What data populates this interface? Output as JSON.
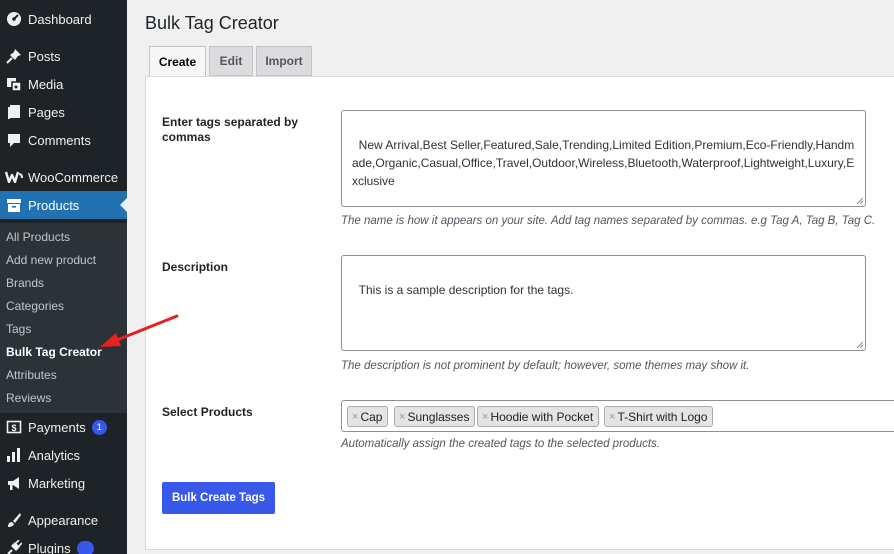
{
  "sidebar": {
    "menu": [
      {
        "label": "Dashboard",
        "icon": "dashboard-icon"
      },
      {
        "label": "Posts",
        "icon": "pin-icon"
      },
      {
        "label": "Media",
        "icon": "media-icon"
      },
      {
        "label": "Pages",
        "icon": "pages-icon"
      },
      {
        "label": "Comments",
        "icon": "comment-icon"
      },
      {
        "label": "WooCommerce",
        "icon": "woo-icon"
      },
      {
        "label": "Products",
        "icon": "archive-icon"
      }
    ],
    "submenu": [
      "All Products",
      "Add new product",
      "Brands",
      "Categories",
      "Tags",
      "Bulk Tag Creator",
      "Attributes",
      "Reviews"
    ],
    "menu_bottom": [
      {
        "label": "Payments",
        "icon": "payments-icon",
        "badge": "1"
      },
      {
        "label": "Analytics",
        "icon": "analytics-icon"
      },
      {
        "label": "Marketing",
        "icon": "megaphone-icon"
      },
      {
        "label": "Appearance",
        "icon": "brush-icon"
      },
      {
        "label": "Plugins",
        "icon": "plugin-icon"
      }
    ]
  },
  "page": {
    "title": "Bulk Tag Creator",
    "tabs": [
      "Create",
      "Edit",
      "Import"
    ],
    "active_tab": "Create"
  },
  "form": {
    "tags_label": "Enter tags separated by commas",
    "tags_value": "New Arrival,Best Seller,Featured,Sale,Trending,Limited Edition,Premium,Eco-Friendly,Handmade,Organic,Casual,Office,Travel,Outdoor,Wireless,Bluetooth,Waterproof,Lightweight,Luxury,Exclusive",
    "tags_help": "The name is how it appears on your site. Add tag names separated by commas. e.g Tag A, Tag B, Tag C.",
    "description_label": "Description",
    "description_value": "This is a sample description for the tags.",
    "description_help": "The description is not prominent by default; however, some themes may show it.",
    "products_label": "Select Products",
    "products": [
      "Cap",
      "Sunglasses",
      "Hoodie with Pocket",
      "T-Shirt with Logo"
    ],
    "chip_remove": "×",
    "products_help": "Automatically assign the created tags to the selected products.",
    "submit_label": "Bulk Create Tags"
  },
  "colors": {
    "sidebar_bg": "#1d2327",
    "submenu_bg": "#2c3338",
    "accent": "#2271b1",
    "button": "#3858e9",
    "annotation_arrow": "#e8201e"
  }
}
